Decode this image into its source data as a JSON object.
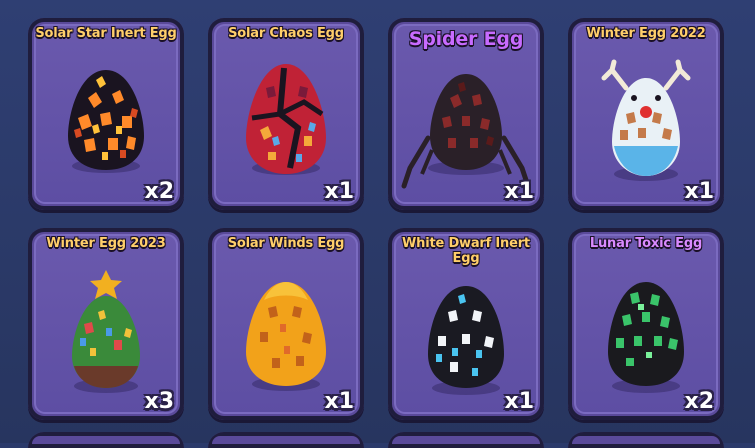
{
  "inventory": {
    "items": [
      {
        "name": "Solar Star Inert Egg",
        "count": "x2"
      },
      {
        "name": "Solar Chaos Egg",
        "count": "x1"
      },
      {
        "name": "Spider Egg",
        "count": "x1"
      },
      {
        "name": "Winter Egg 2022",
        "count": "x1"
      },
      {
        "name": "Winter Egg 2023",
        "count": "x3"
      },
      {
        "name": "Solar Winds Egg",
        "count": "x1"
      },
      {
        "name": "White Dwarf Inert Egg",
        "count": "x1"
      },
      {
        "name": "Lunar Toxic Egg",
        "count": "x2"
      }
    ]
  },
  "colors": {
    "card_bg": "#5a4a9a",
    "card_border": "#1f1d3d",
    "title_default": "#ffcf6a",
    "title_spider": "#c86bff",
    "title_lunar": "#d98aff",
    "background": "#2b3a6b"
  },
  "icons": [
    "solar-star-egg-icon",
    "solar-chaos-egg-icon",
    "spider-egg-icon",
    "winter-2022-egg-icon",
    "winter-2023-egg-icon",
    "solar-winds-egg-icon",
    "white-dwarf-egg-icon",
    "lunar-toxic-egg-icon"
  ]
}
